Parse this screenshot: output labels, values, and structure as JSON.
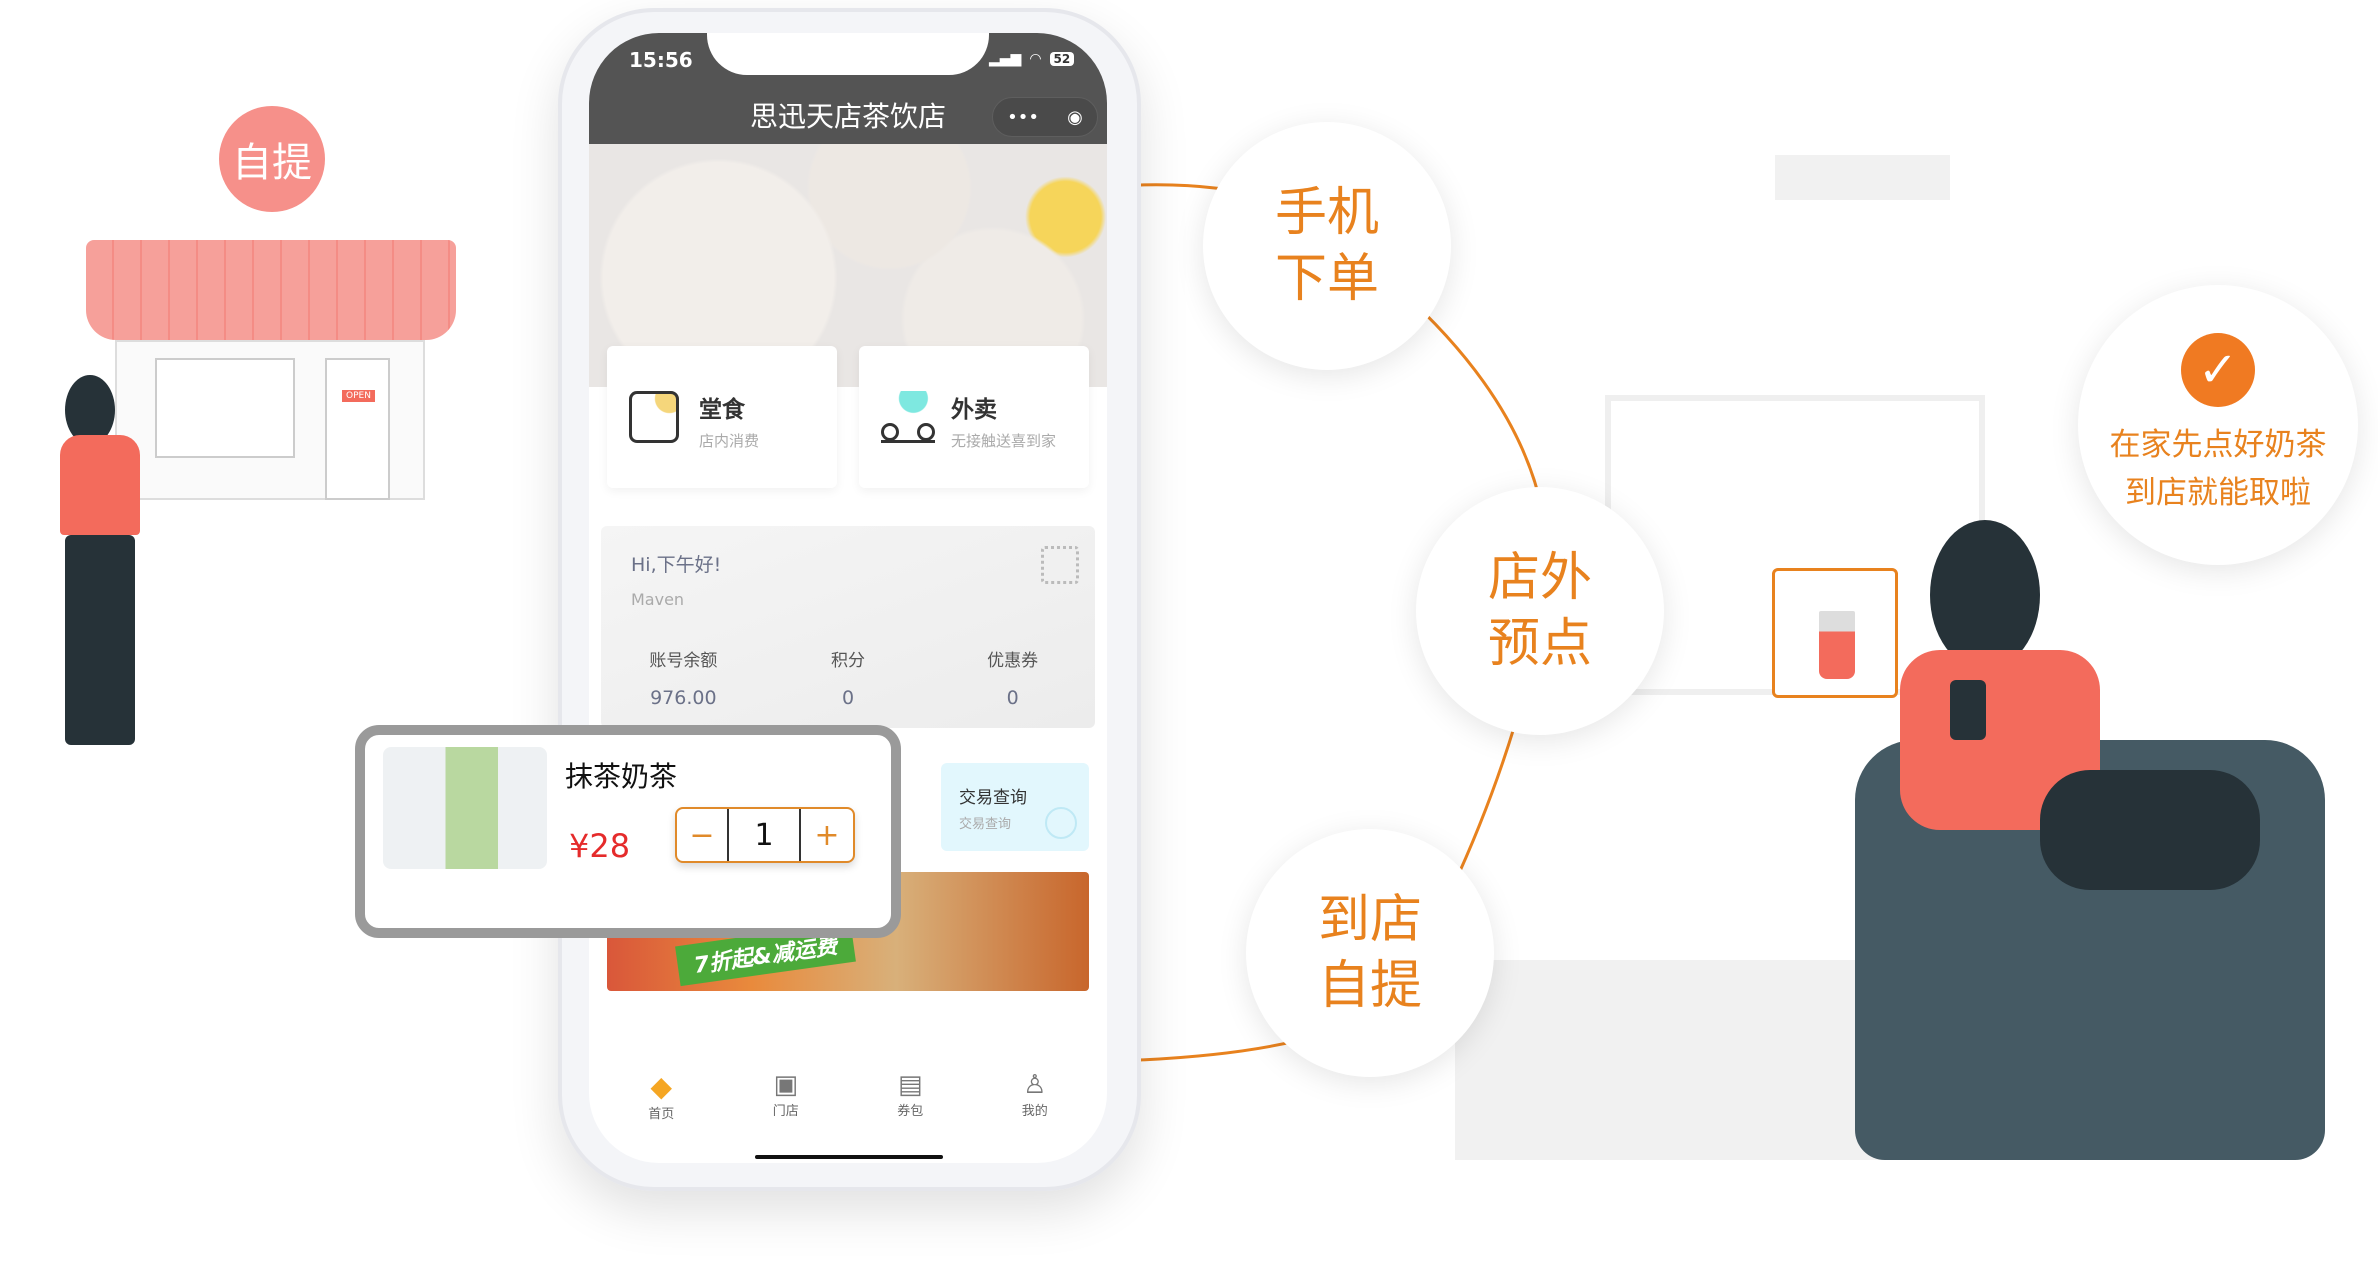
{
  "status_bar": {
    "time": "15:56",
    "battery": "52"
  },
  "mini_program": {
    "title": "思迅天店茶饮店",
    "more_icon": "more-dots-icon",
    "close_icon": "target-circle-icon"
  },
  "order_modes": [
    {
      "title": "堂食",
      "subtitle": "店内消费",
      "icon": "storefront-icon"
    },
    {
      "title": "外卖",
      "subtitle": "无接触送喜到家",
      "icon": "scooter-icon"
    }
  ],
  "member": {
    "greeting": "Hi,下午好!",
    "name": "Maven",
    "stats": [
      {
        "label": "账号余额",
        "value": "976.00"
      },
      {
        "label": "积分",
        "value": "0"
      },
      {
        "label": "优惠券",
        "value": "0"
      }
    ]
  },
  "tile": {
    "title": "交易查询",
    "subtitle": "交易查询"
  },
  "promo": {
    "text": "7折起&减运费"
  },
  "product": {
    "name": "抹茶奶茶",
    "price": "¥28",
    "quantity": "1",
    "minus": "−",
    "plus": "+"
  },
  "tabbar": [
    {
      "label": "首页",
      "active": true
    },
    {
      "label": "门店"
    },
    {
      "label": "券包"
    },
    {
      "label": "我的"
    }
  ],
  "illustration": {
    "pickup_bubble": "自提",
    "open_sign": "OPEN",
    "steps": [
      "手机\n下单",
      "店外\n预点",
      "到店\n自提"
    ],
    "callout": "在家先点好奶茶\n到店就能取啦"
  },
  "colors": {
    "accent": "#e8821e",
    "price": "#e52b2b",
    "header": "#545454",
    "pink": "#f6908a"
  }
}
